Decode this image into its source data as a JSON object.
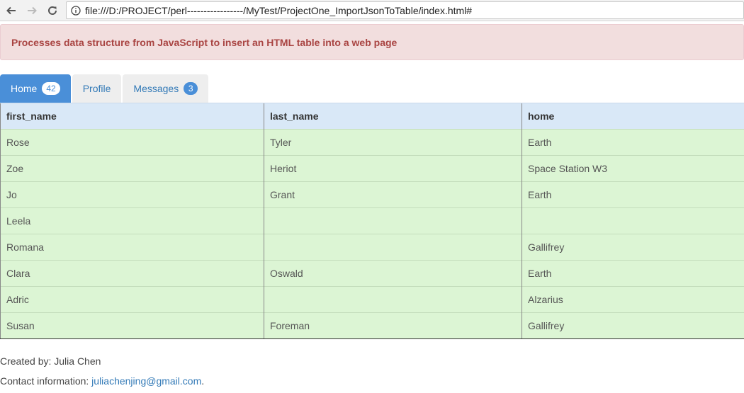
{
  "browser": {
    "url": "file:///D:/PROJECT/perl-----------------/MyTest/ProjectOne_ImportJsonToTable/index.html#",
    "back_icon": "arrow-left-icon",
    "forward_icon": "arrow-right-icon",
    "reload_icon": "reload-icon",
    "info_icon": "info-icon"
  },
  "alert": {
    "text": "Processes data structure from JavaScript to insert an HTML table into a web page"
  },
  "tabs": [
    {
      "label": "Home",
      "badge": "42",
      "active": true
    },
    {
      "label": "Profile",
      "active": false
    },
    {
      "label": "Messages",
      "badge": "3",
      "active": false
    }
  ],
  "table": {
    "headers": [
      "first_name",
      "last_name",
      "home"
    ],
    "rows": [
      [
        "Rose",
        "Tyler",
        "Earth"
      ],
      [
        "Zoe",
        "Heriot",
        "Space Station W3"
      ],
      [
        "Jo",
        "Grant",
        "Earth"
      ],
      [
        "Leela",
        "",
        ""
      ],
      [
        "Romana",
        "",
        "Gallifrey"
      ],
      [
        "Clara",
        "Oswald",
        "Earth"
      ],
      [
        "Adric",
        "",
        "Alzarius"
      ],
      [
        "Susan",
        "Foreman",
        "Gallifrey"
      ]
    ]
  },
  "footer": {
    "created_by": "Created by: Julia Chen",
    "contact_label": "Contact information: ",
    "contact_email": "juliachenjing@gmail.com",
    "contact_suffix": "."
  },
  "colors": {
    "alert_bg": "#f2dede",
    "alert_text": "#a94442",
    "tab_active_bg": "#4a8fd8",
    "header_bg": "#d9e8f7",
    "row_bg": "#dcf5d4",
    "link": "#337ab7"
  }
}
